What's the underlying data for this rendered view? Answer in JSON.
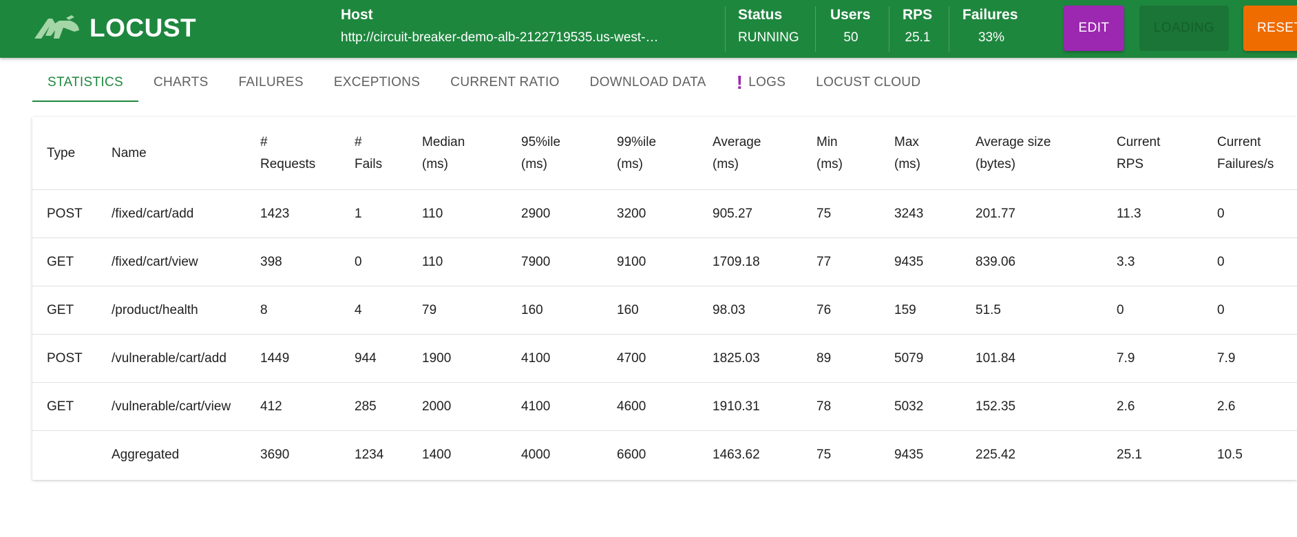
{
  "app": {
    "name": "LOCUST",
    "logo_icon": "locust-logo-icon"
  },
  "header": {
    "host": {
      "label": "Host",
      "value": "http://circuit-breaker-demo-alb-2122719535.us-west-…"
    },
    "status": {
      "label": "Status",
      "value": "RUNNING"
    },
    "users": {
      "label": "Users",
      "value": "50"
    },
    "rps": {
      "label": "RPS",
      "value": "25.1"
    },
    "failures": {
      "label": "Failures",
      "value": "33%"
    },
    "buttons": {
      "edit": "EDIT",
      "loading": "LOADING",
      "reset": "RESET"
    }
  },
  "tabs": [
    {
      "label": "STATISTICS",
      "active": true
    },
    {
      "label": "CHARTS"
    },
    {
      "label": "FAILURES"
    },
    {
      "label": "EXCEPTIONS"
    },
    {
      "label": "CURRENT RATIO"
    },
    {
      "label": "DOWNLOAD DATA"
    },
    {
      "label": "LOGS",
      "icon": "exclamation-icon"
    },
    {
      "label": "LOCUST CLOUD"
    }
  ],
  "table": {
    "columns": [
      [
        "Type"
      ],
      [
        "Name"
      ],
      [
        "#",
        "Requests"
      ],
      [
        "#",
        "Fails"
      ],
      [
        "Median",
        "(ms)"
      ],
      [
        "95%ile",
        "(ms)"
      ],
      [
        "99%ile",
        "(ms)"
      ],
      [
        "Average",
        "(ms)"
      ],
      [
        "Min",
        "(ms)"
      ],
      [
        "Max",
        "(ms)"
      ],
      [
        "Average size",
        "(bytes)"
      ],
      [
        "Current",
        "RPS"
      ],
      [
        "Current",
        "Failures/s"
      ]
    ],
    "rows": [
      [
        "POST",
        "/fixed/cart/add",
        "1423",
        "1",
        "110",
        "2900",
        "3200",
        "905.27",
        "75",
        "3243",
        "201.77",
        "11.3",
        "0"
      ],
      [
        "GET",
        "/fixed/cart/view",
        "398",
        "0",
        "110",
        "7900",
        "9100",
        "1709.18",
        "77",
        "9435",
        "839.06",
        "3.3",
        "0"
      ],
      [
        "GET",
        "/product/health",
        "8",
        "4",
        "79",
        "160",
        "160",
        "98.03",
        "76",
        "159",
        "51.5",
        "0",
        "0"
      ],
      [
        "POST",
        "/vulnerable/cart/add",
        "1449",
        "944",
        "1900",
        "4100",
        "4700",
        "1825.03",
        "89",
        "5079",
        "101.84",
        "7.9",
        "7.9"
      ],
      [
        "GET",
        "/vulnerable/cart/view",
        "412",
        "285",
        "2000",
        "4100",
        "4600",
        "1910.31",
        "78",
        "5032",
        "152.35",
        "2.6",
        "2.6"
      ],
      [
        "",
        "Aggregated",
        "3690",
        "1234",
        "1400",
        "4000",
        "6600",
        "1463.62",
        "75",
        "9435",
        "225.42",
        "25.1",
        "10.5"
      ]
    ]
  },
  "colors": {
    "navbar": "#1e873e",
    "edit_button": "#9c27b0",
    "reset_button": "#ef6c00",
    "active_tab": "#1e873e",
    "logs_warning": "#9c27b0"
  }
}
